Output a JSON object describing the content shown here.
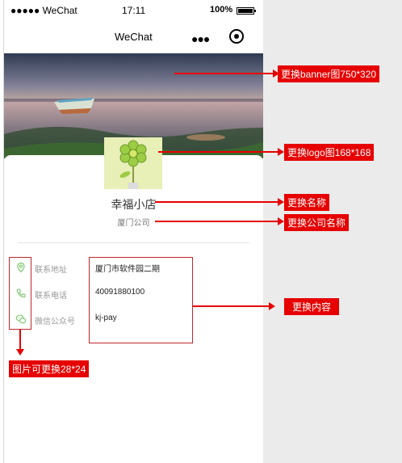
{
  "status_bar": {
    "carrier": "●●●●● WeChat",
    "time": "17:11",
    "battery": "100%"
  },
  "nav": {
    "title": "WeChat",
    "more_icon": "more-dots-icon",
    "target_icon": "record-target-icon"
  },
  "shop": {
    "name": "幸福小店",
    "company": "厦门公司"
  },
  "info": [
    {
      "icon": "location-pin-icon",
      "label": "联系地址",
      "value": "厦门市软件园二期"
    },
    {
      "icon": "phone-icon",
      "label": "联系电话",
      "value": "40091880100"
    },
    {
      "icon": "wechat-icon",
      "label": "微信公众号",
      "value": "kj-pay"
    }
  ],
  "callouts": {
    "banner": "更换banner图750*320",
    "logo": "更换logo图168*168",
    "name": "更换名称",
    "company": "更换公司名称",
    "content": "更换内容",
    "icons": "图片可更换28*24"
  },
  "colors": {
    "accent_red": "#e60000",
    "box_red": "#c0262d",
    "icon_green": "#7cc46a",
    "side_panel": "#ebebeb"
  }
}
